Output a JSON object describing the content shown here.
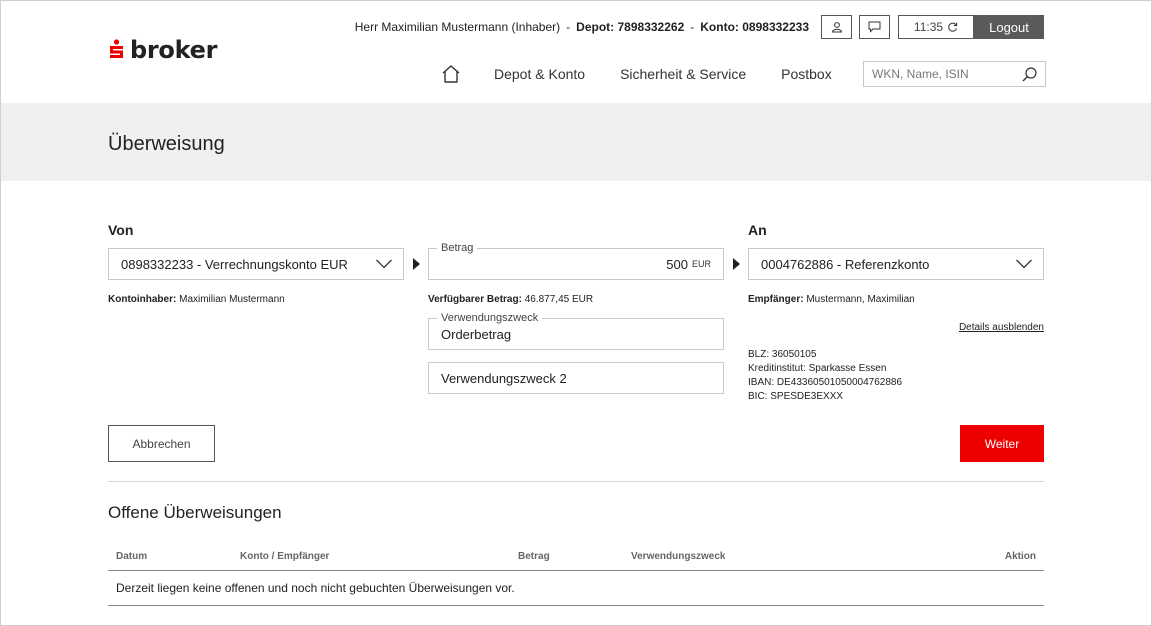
{
  "brand": {
    "name": "broker",
    "accent_color": "#ee0000"
  },
  "header": {
    "user_name": "Herr Maximilian Mustermann (Inhaber)",
    "depot_label": "Depot:",
    "depot_number": "7898332262",
    "konto_label": "Konto:",
    "konto_number": "0898332233",
    "profile_icon": "user-icon",
    "message_icon": "message-icon",
    "session_time": "11:35",
    "refresh_icon": "refresh-icon",
    "logout_label": "Logout"
  },
  "nav": {
    "home_icon": "home-icon",
    "items": [
      "Depot & Konto",
      "Sicherheit & Service",
      "Postbox"
    ],
    "search_placeholder": "WKN, Name, ISIN",
    "search_icon": "search-icon"
  },
  "page": {
    "title": "Überweisung"
  },
  "from": {
    "label": "Von",
    "account": "0898332233 - Verrechnungskonto EUR",
    "owner_label": "Kontoinhaber:",
    "owner": "Maximilian Mustermann"
  },
  "amount": {
    "legend": "Betrag",
    "value": "500",
    "currency": "EUR",
    "available_label": "Verfügbarer Betrag:",
    "available": "46.877,45 EUR"
  },
  "purpose": {
    "legend": "Verwendungszweck",
    "value": "Orderbetrag",
    "placeholder2": "Verwendungszweck 2"
  },
  "to": {
    "label": "An",
    "account": "0004762886 - Referenzkonto",
    "recipient_label": "Empfänger:",
    "recipient": "Mustermann, Maximilian",
    "details_link": "Details ausblenden",
    "blz": "BLZ: 36050105",
    "bank": "Kreditinstitut: Sparkasse Essen",
    "iban": "IBAN: DE43360501050004762886",
    "bic": "BIC: SPESDE3EXXX"
  },
  "actions": {
    "cancel": "Abbrechen",
    "next": "Weiter"
  },
  "open_transfers": {
    "title": "Offene Überweisungen",
    "columns": [
      "Datum",
      "Konto / Empfänger",
      "Betrag",
      "Verwendungszweck",
      "Aktion"
    ],
    "empty_message": "Derzeit liegen keine offenen und noch nicht gebuchten Überweisungen vor."
  }
}
